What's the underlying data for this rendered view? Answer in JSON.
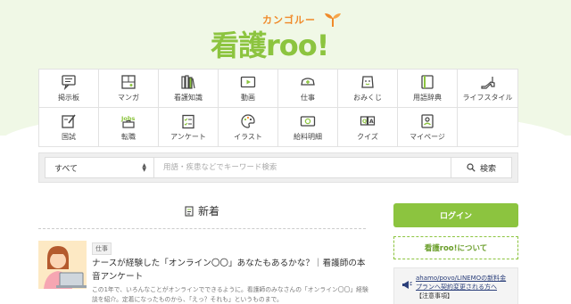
{
  "logo": {
    "ruby": "カンゴルー",
    "kanji": "看護",
    "roman": "roo",
    "bang": "!"
  },
  "menu": {
    "items": [
      {
        "label": "掲示板",
        "icon": "bulletin-board-icon"
      },
      {
        "label": "マンガ",
        "icon": "manga-icon"
      },
      {
        "label": "看護知識",
        "icon": "books-icon"
      },
      {
        "label": "動画",
        "icon": "video-icon"
      },
      {
        "label": "仕事",
        "icon": "nurse-cap-icon"
      },
      {
        "label": "おみくじ",
        "icon": "omikuji-icon"
      },
      {
        "label": "用語辞典",
        "icon": "dictionary-icon"
      },
      {
        "label": "ライフスタイル",
        "icon": "high-heel-icon"
      },
      {
        "label": "国試",
        "icon": "exam-icon"
      },
      {
        "label": "転職",
        "icon": "jobs-icon"
      },
      {
        "label": "アンケート",
        "icon": "survey-icon"
      },
      {
        "label": "イラスト",
        "icon": "palette-icon"
      },
      {
        "label": "給料明細",
        "icon": "money-icon"
      },
      {
        "label": "クイズ",
        "icon": "quiz-icon"
      },
      {
        "label": "マイページ",
        "icon": "my-page-icon"
      }
    ]
  },
  "search": {
    "select_value": "すべて",
    "placeholder": "用語・疾患などでキーワード検索",
    "button_label": "検索"
  },
  "new_section": {
    "title": "新着"
  },
  "article": {
    "tag": "仕事",
    "title": "ナースが経験した「オンライン〇〇」あなたもあるかな？｜看護師の本音アンケート",
    "excerpt": "この1年で、いろんなことがオンラインでできるように。看護師のみなさんの「オンライン〇〇」経験談を紹介。定着になったものから、「えっ？それも」というものまで。"
  },
  "sidebar": {
    "login_label": "ログイン",
    "about_label": "看護roo!について",
    "notice_link": "ahamo/povo/LINEMOの新料金プランへ契約変更される方へ",
    "notice_note": "【注意事項】"
  },
  "colors": {
    "brand_green": "#8cc43f",
    "band_bg": "#f0f8e6",
    "accent_orange": "#f08a2a"
  }
}
